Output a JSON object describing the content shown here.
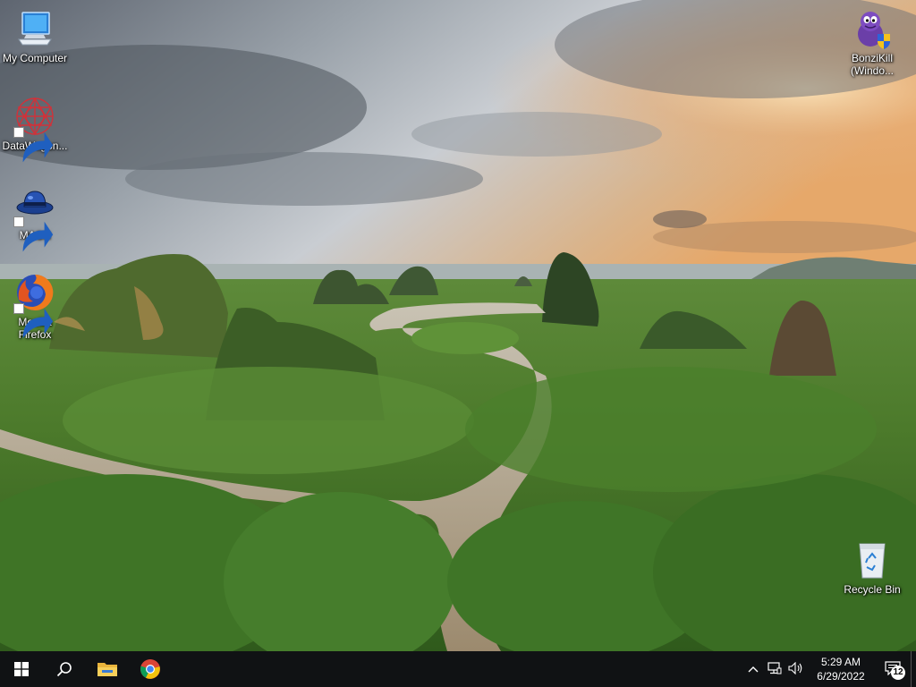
{
  "desktop": {
    "icons_left": [
      {
        "id": "my-computer",
        "label": "My Computer",
        "icon": "computer-icon"
      },
      {
        "id": "datawagon",
        "label": "DataWagon...",
        "icon": "datawagon-icon"
      },
      {
        "id": "mash",
        "label": "MASH",
        "icon": "mash-hat-icon"
      },
      {
        "id": "firefox",
        "label": "Mozilla Firefox",
        "icon": "firefox-icon"
      }
    ],
    "icons_right": [
      {
        "id": "bonzikill",
        "label": "BonziKill (Windo...",
        "icon": "bonzi-icon"
      },
      {
        "id": "recycle-bin",
        "label": "Recycle Bin",
        "icon": "recycle-bin-icon"
      }
    ]
  },
  "taskbar": {
    "start_icon": "windows-logo-icon",
    "search_icon": "search-icon",
    "pinned": [
      {
        "id": "file-explorer",
        "icon": "folder-icon"
      },
      {
        "id": "chrome",
        "icon": "chrome-icon"
      }
    ],
    "tray": {
      "chevron_icon": "chevron-up-icon",
      "network_icon": "network-icon",
      "volume_icon": "volume-icon",
      "time": "5:29 AM",
      "date": "6/29/2022",
      "notification_count": "12"
    }
  },
  "colors": {
    "taskbar": "#101214",
    "accent": "#76b9ed"
  }
}
